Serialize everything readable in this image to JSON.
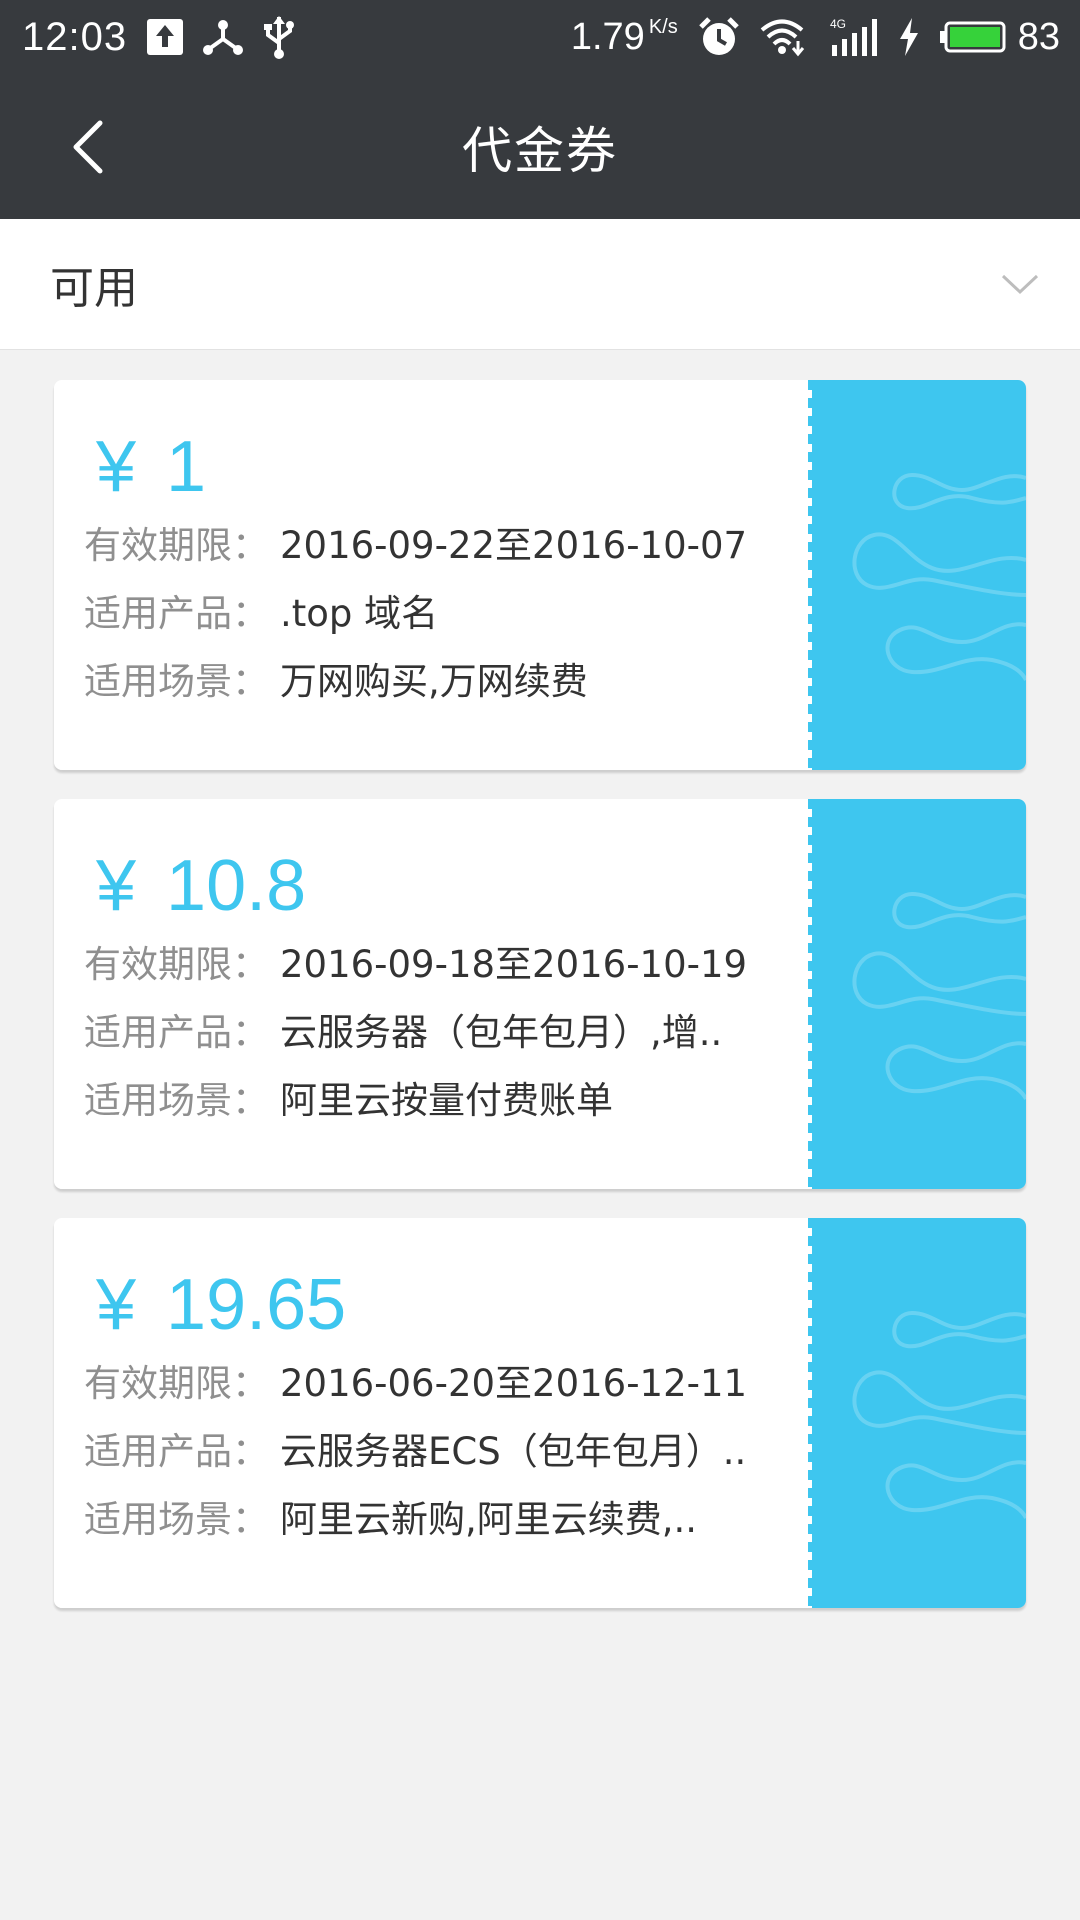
{
  "status_bar": {
    "time": "12:03",
    "speed": "1.79",
    "speed_unit": "K/s",
    "battery": "83",
    "icons": [
      "upload-icon",
      "usb-tether-icon",
      "usb-icon",
      "alarm-icon",
      "wifi-icon",
      "signal-4g-icon",
      "charging-icon",
      "battery-icon"
    ]
  },
  "header": {
    "title": "代金券",
    "back_icon": "chevron-left-icon"
  },
  "filter": {
    "label": "可用",
    "icon": "chevron-down-icon"
  },
  "colors": {
    "accent": "#3ec6ef",
    "header_bg": "#373a3e",
    "page_bg": "#f2f2f2"
  },
  "coupons": [
    {
      "currency": "¥",
      "amount": "1",
      "validity_label": "有效期限：",
      "validity": "2016-09-22至2016-10-07",
      "product_label": "适用产品：",
      "product": ".top 域名",
      "scene_label": "适用场景：",
      "scene": "万网购买,万网续费"
    },
    {
      "currency": "¥",
      "amount": "10.8",
      "validity_label": "有效期限：",
      "validity": "2016-09-18至2016-10-19",
      "product_label": "适用产品：",
      "product": "云服务器（包年包月）,增..",
      "scene_label": "适用场景：",
      "scene": "阿里云按量付费账单"
    },
    {
      "currency": "¥",
      "amount": "19.65",
      "validity_label": "有效期限：",
      "validity": "2016-06-20至2016-12-11",
      "product_label": "适用产品：",
      "product": "云服务器ECS（包年包月）..",
      "scene_label": "适用场景：",
      "scene": "阿里云新购,阿里云续费,.."
    }
  ]
}
